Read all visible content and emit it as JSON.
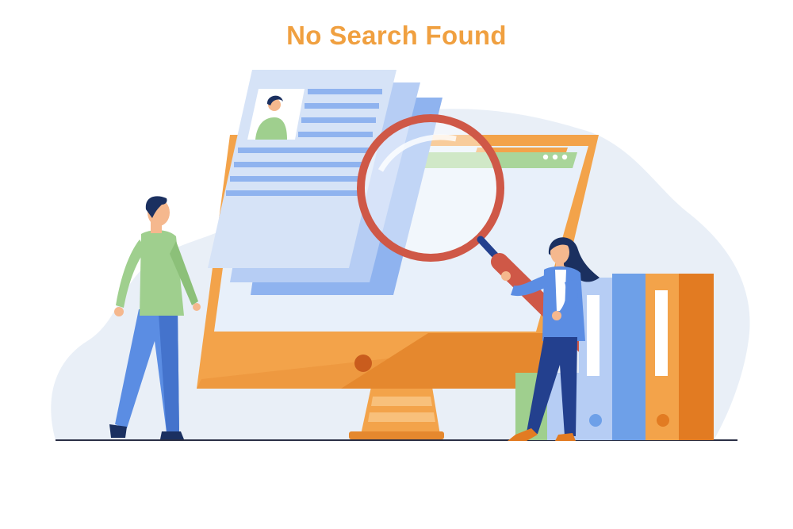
{
  "page": {
    "title": "No Search Found"
  },
  "colors": {
    "title": "#f0a040",
    "blob_background": "#e9eff7",
    "monitor_orange": "#f3a34a",
    "monitor_dark_orange": "#e5882e",
    "screen": "#e8f0fa",
    "browser_bar": "#a9d59a",
    "document_blue": "#8fb3ef",
    "magnifier_red": "#cf5847",
    "man_shirt": "#9fcf8e",
    "man_pants": "#5b8de3",
    "woman_jacket": "#5b8de3",
    "woman_pants": "#23408e",
    "folder_blue": "#6ea0e8",
    "folder_orange": "#e27b22",
    "hair": "#1b3060",
    "skin": "#f5b88e"
  },
  "illustration": {
    "icons": [
      "empty-search-illustration",
      "magnifier-icon",
      "browser-window-icon",
      "document-icon",
      "folder-icon"
    ]
  }
}
